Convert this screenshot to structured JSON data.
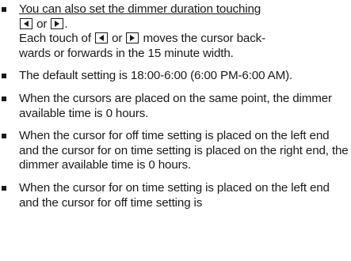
{
  "items": [
    {
      "lines": [
        "You can also set the dimmer duration touching",
        "or",
        ".",
        "Each touch of",
        "or",
        "moves the cursor back-",
        "wards or forwards in the 15 minute width."
      ]
    },
    {
      "text": "The default setting is 18:00-6:00 (6:00 PM-6:00 AM)."
    },
    {
      "text": "When the cursors are placed on the same point, the dimmer available time is 0 hours."
    },
    {
      "text": "When the cursor for off time setting is placed on the left end and the cursor for on time setting is placed on the right end, the dimmer available time is 0 hours."
    },
    {
      "text": "When the cursor for on time setting is placed on the left end and the cursor for off time setting is"
    }
  ],
  "icons": {
    "left": "left-arrow-button-icon",
    "right": "right-arrow-button-icon"
  }
}
